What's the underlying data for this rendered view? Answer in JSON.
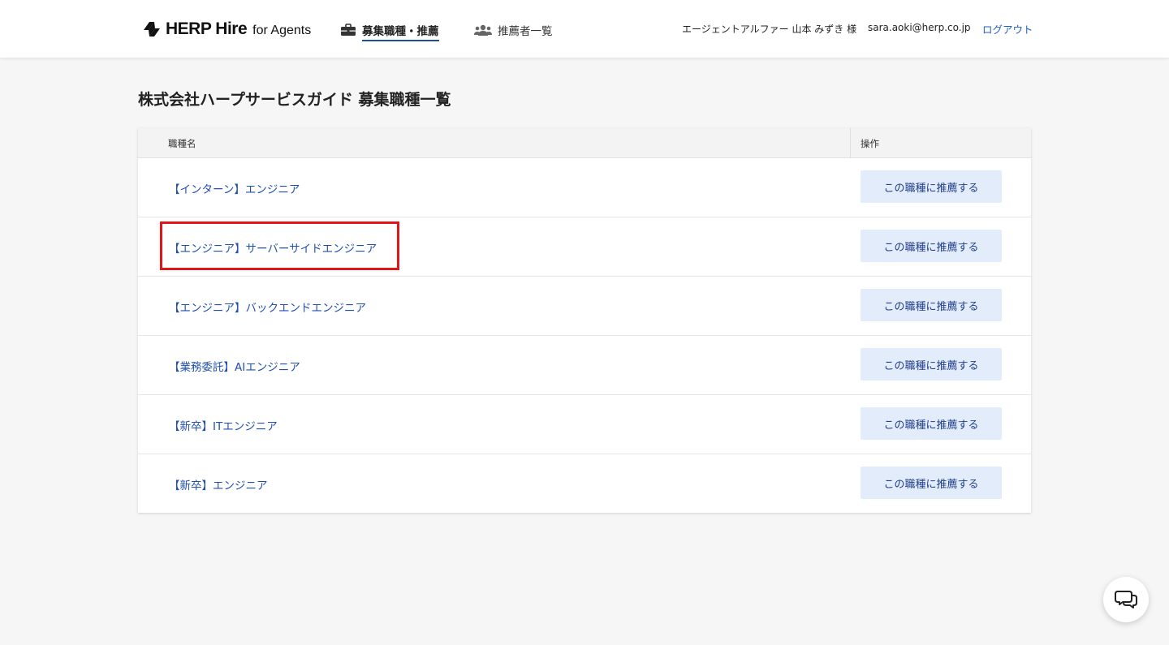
{
  "header": {
    "logo_main": "HERP Hire",
    "logo_sub": "for Agents",
    "nav": [
      {
        "label": "募集職種・推薦",
        "icon": "briefcase-icon",
        "active": true
      },
      {
        "label": "推薦者一覧",
        "icon": "users-icon",
        "active": false
      }
    ],
    "user_name": "エージェントアルファー 山本 みずき 様",
    "user_email": "sara.aoki@herp.co.jp",
    "logout_label": "ログアウト"
  },
  "page_title": "株式会社ハープサービスガイド 募集職種一覧",
  "table": {
    "columns": [
      "職種名",
      "操作"
    ],
    "rows": [
      {
        "job": "【インターン】エンジニア",
        "action": "この職種に推薦する"
      },
      {
        "job": "【エンジニア】サーバーサイドエンジニア",
        "action": "この職種に推薦する"
      },
      {
        "job": "【エンジニア】バックエンドエンジニア",
        "action": "この職種に推薦する"
      },
      {
        "job": "【業務委託】AIエンジニア",
        "action": "この職種に推薦する"
      },
      {
        "job": "【新卒】ITエンジニア",
        "action": "この職種に推薦する"
      },
      {
        "job": "【新卒】エンジニア",
        "action": "この職種に推薦する"
      }
    ]
  },
  "colors": {
    "accent": "#1f4fb4",
    "button_bg": "#e3ecfa",
    "highlight": "#e0161b"
  },
  "chat_icon": "chat-bubbles-icon"
}
